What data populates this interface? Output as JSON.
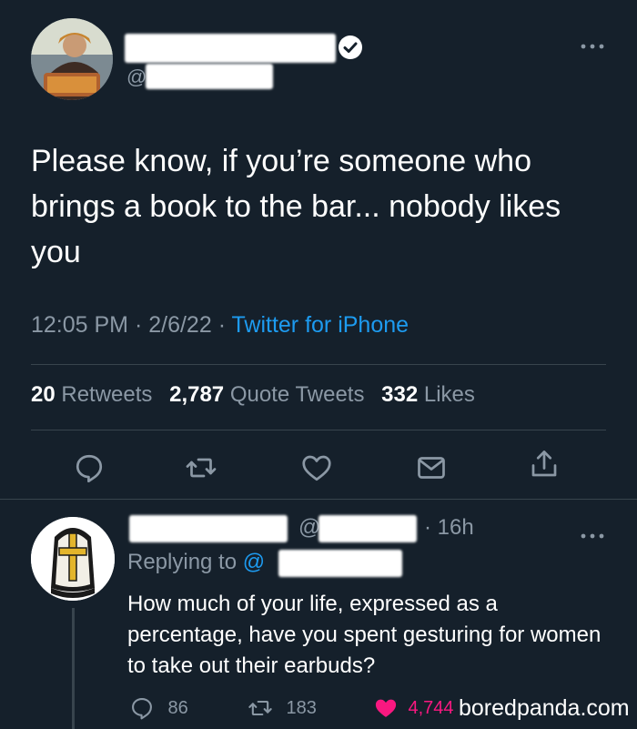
{
  "tweet": {
    "handle_prefix": "@",
    "menu_icon": "more-horizontal-icon",
    "text": "Please know, if you’re someone who brings a book to the bar... nobody likes you",
    "time": "12:05 PM",
    "sep1": " · ",
    "date": "2/6/22",
    "sep2": " · ",
    "source": "Twitter for iPhone",
    "stats": {
      "retweets_count": "20",
      "retweets_label": "Retweets",
      "quotes_count": "2,787",
      "quotes_label": "Quote Tweets",
      "likes_count": "332",
      "likes_label": "Likes"
    },
    "actions": [
      "reply-icon",
      "retweet-icon",
      "like-icon",
      "share-dm-icon",
      "share-icon"
    ]
  },
  "reply": {
    "at": "@",
    "time_sep": "·",
    "time": "16h",
    "replying_prefix": "Replying to ",
    "replying_handle": "@",
    "text": "How much of your life, expressed as a percentage, have you spent gesturing for women to take out their earbuds?",
    "reply_count": "86",
    "retweet_count": "183",
    "like_count": "4,744",
    "like_color": "#f91880"
  },
  "watermark": {
    "text": "boredpanda.com"
  },
  "colors": {
    "background": "#15202b",
    "secondary_text": "#8b98a5",
    "link": "#1d9bf0",
    "divider": "#38444d"
  }
}
